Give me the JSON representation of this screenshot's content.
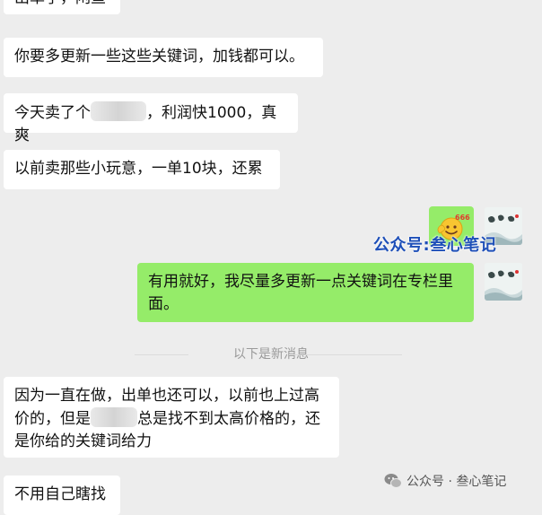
{
  "messages": {
    "m0": "出单了，闲鱼",
    "m1": "你要多更新一些这些关键词，加钱都可以。",
    "m2_a": "今天卖了个",
    "m2_b": "，利润快1000，真爽",
    "m3": "以前卖那些小玩意，一单10块，还累",
    "sent_emoji": "666",
    "m4": "有用就好，我尽量多更新一点关键词在专栏里面。",
    "m5_a": "因为一直在做，出单也还可以，以前也上过高价的，但是",
    "m5_b": "总是找不到太高价格的，还是你给的关键词给力",
    "m6": "不用自己瞎找"
  },
  "divider": {
    "label": "以下是新消息"
  },
  "watermark": {
    "mid": "公众号:叁心笔记",
    "bottom": "公众号 · 叁心笔记"
  },
  "colors": {
    "background": "#ededed",
    "bubble_in": "#ffffff",
    "bubble_out": "#95ec69",
    "watermark_blue": "#1e4fb8"
  }
}
